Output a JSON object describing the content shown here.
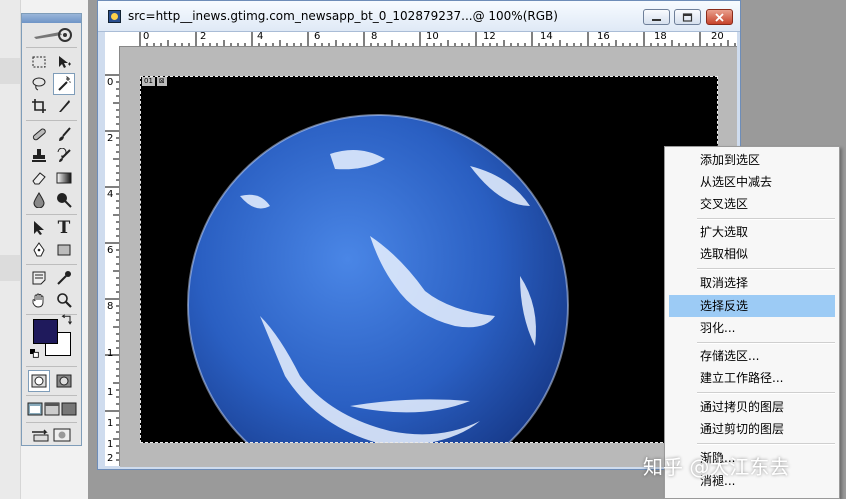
{
  "document": {
    "title": "src=http__inews.gtimg.com_newsapp_bt_0_102879237...@ 100%(RGB)",
    "layer_tags": [
      "01",
      "⊠"
    ]
  },
  "rulers": {
    "top": [
      "0",
      "2",
      "4",
      "6",
      "8",
      "10",
      "12",
      "14",
      "16",
      "18",
      "20"
    ],
    "left": [
      "0",
      "2",
      "4",
      "6",
      "8",
      "1",
      "1",
      "1",
      "1",
      "2"
    ]
  },
  "toolbox": {
    "tools": [
      "marquee-icon",
      "move-icon",
      "lasso-icon",
      "magic-wand-icon",
      "crop-icon",
      "slice-icon",
      "healing-brush-icon",
      "brush-icon",
      "clone-stamp-icon",
      "history-brush-icon",
      "eraser-icon",
      "gradient-icon",
      "blur-icon",
      "dodge-icon",
      "path-select-icon",
      "type-icon",
      "pen-icon",
      "shape-icon",
      "notes-icon",
      "eyedropper-icon",
      "hand-icon",
      "zoom-icon"
    ],
    "type_tool_glyph": "T",
    "active_tool": "magic-wand-icon",
    "foreground_color": "#1f1a5c",
    "background_color": "#ffffff"
  },
  "context_menu": {
    "items": [
      {
        "label": "添加到选区"
      },
      {
        "label": "从选区中减去"
      },
      {
        "label": "交叉选区"
      },
      {
        "label": "扩大选取"
      },
      {
        "label": "选取相似"
      },
      {
        "label": "取消选择"
      },
      {
        "label": "选择反选",
        "highlighted": true
      },
      {
        "label": "羽化..."
      },
      {
        "label": "存储选区..."
      },
      {
        "label": "建立工作路径..."
      },
      {
        "label": "通过拷贝的图层"
      },
      {
        "label": "通过剪切的图层"
      },
      {
        "label": "渐隐..."
      },
      {
        "label": "消褪..."
      }
    ],
    "highlight_color": "#9ccbf5"
  },
  "watermark": "知乎 @大江东去",
  "colors": {
    "planet_ocean": "#2a5fc2",
    "canvas_background": "#000000",
    "workspace_gray": "#9a9a9a"
  }
}
